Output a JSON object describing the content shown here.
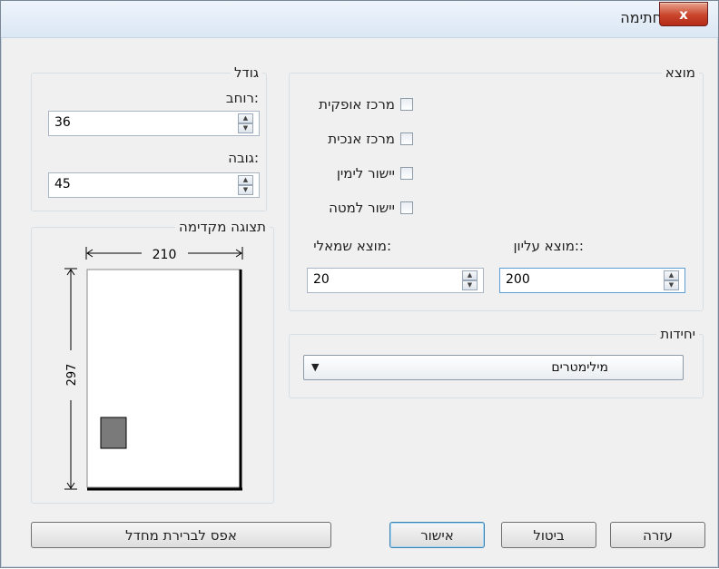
{
  "window": {
    "title": "מיקום חתימה",
    "close_glyph": "x"
  },
  "size": {
    "legend": "גודל",
    "width_label": ":רוחב",
    "width_value": "36",
    "height_label": ":גובה",
    "height_value": "45"
  },
  "preview": {
    "legend": "תצוגה מקדימה",
    "width_dim": "210",
    "height_dim": "297"
  },
  "position": {
    "legend": "מוצא",
    "checkboxes": [
      {
        "label": "מרכז אופקית",
        "checked": false
      },
      {
        "label": "מרכז אנכית",
        "checked": false
      },
      {
        "label": "יישור לימין",
        "checked": false
      },
      {
        "label": "יישור למטה",
        "checked": false
      }
    ],
    "left_offset_label": ":מוצא שמאלי",
    "left_offset_value": "20",
    "top_offset_label": "::מוצא עליון",
    "top_offset_value": "200"
  },
  "units": {
    "legend": "יחידות",
    "selected": "מילימטרים"
  },
  "buttons": {
    "reset": "אפס לברירת מחדל",
    "ok": "אישור",
    "cancel": "ביטול",
    "help": "עזרה"
  },
  "icons": {
    "spin_up": "▲",
    "spin_down": "▼",
    "dropdown": "▼"
  }
}
